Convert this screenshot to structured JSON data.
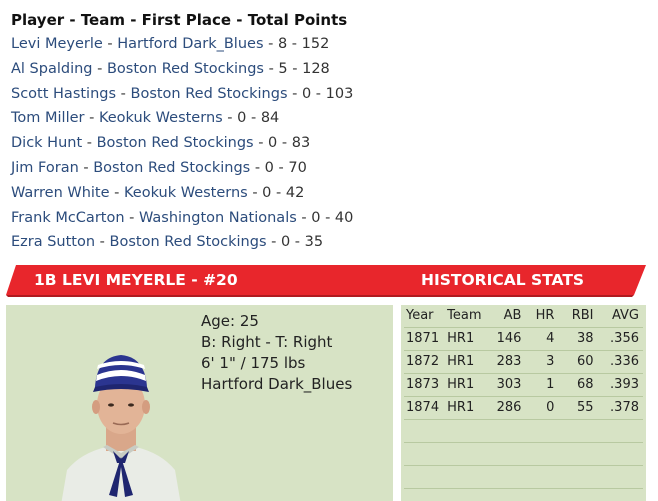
{
  "leaderboard": {
    "header": "Player - Team - First Place - Total Points",
    "rows": [
      {
        "player": "Levi Meyerle",
        "team": "Hartford Dark_Blues",
        "rest": " - 8 - 152"
      },
      {
        "player": "Al Spalding",
        "team": "Boston Red Stockings",
        "rest": " - 5 - 128"
      },
      {
        "player": "Scott Hastings",
        "team": "Boston Red Stockings",
        "rest": " - 0 - 103"
      },
      {
        "player": "Tom Miller",
        "team": "Keokuk Westerns",
        "rest": " - 0 - 84"
      },
      {
        "player": "Dick Hunt",
        "team": "Boston Red Stockings",
        "rest": " - 0 - 83"
      },
      {
        "player": "Jim Foran",
        "team": "Boston Red Stockings",
        "rest": " - 0 - 70"
      },
      {
        "player": "Warren White",
        "team": "Keokuk Westerns",
        "rest": " - 0 - 42"
      },
      {
        "player": "Frank McCarton",
        "team": "Washington Nationals",
        "rest": " - 0 - 40"
      },
      {
        "player": "Ezra Sutton",
        "team": "Boston Red Stockings",
        "rest": " - 0 - 35"
      }
    ],
    "separator": " - "
  },
  "banner": {
    "player_title": "1B LEVI MEYERLE - #20",
    "stats_title": "HISTORICAL STATS",
    "color": "#e8262c"
  },
  "player": {
    "age": "Age: 25",
    "bats_throws": "B: Right - T: Right",
    "height_weight": "6' 1\" / 175 lbs",
    "team": "Hartford Dark_Blues"
  },
  "stats": {
    "columns": [
      "Year",
      "Team",
      "AB",
      "HR",
      "RBI",
      "AVG"
    ],
    "rows": [
      [
        "1871",
        "HR1",
        "146",
        "4",
        "38",
        ".356"
      ],
      [
        "1872",
        "HR1",
        "283",
        "3",
        "60",
        ".336"
      ],
      [
        "1873",
        "HR1",
        "303",
        "1",
        "68",
        ".393"
      ],
      [
        "1874",
        "HR1",
        "286",
        "0",
        "55",
        ".378"
      ]
    ],
    "empty_rows": 3
  },
  "colors": {
    "panel_bg": "#d7e3c5",
    "link": "#2c4c7c",
    "banner_red": "#e8262c"
  }
}
